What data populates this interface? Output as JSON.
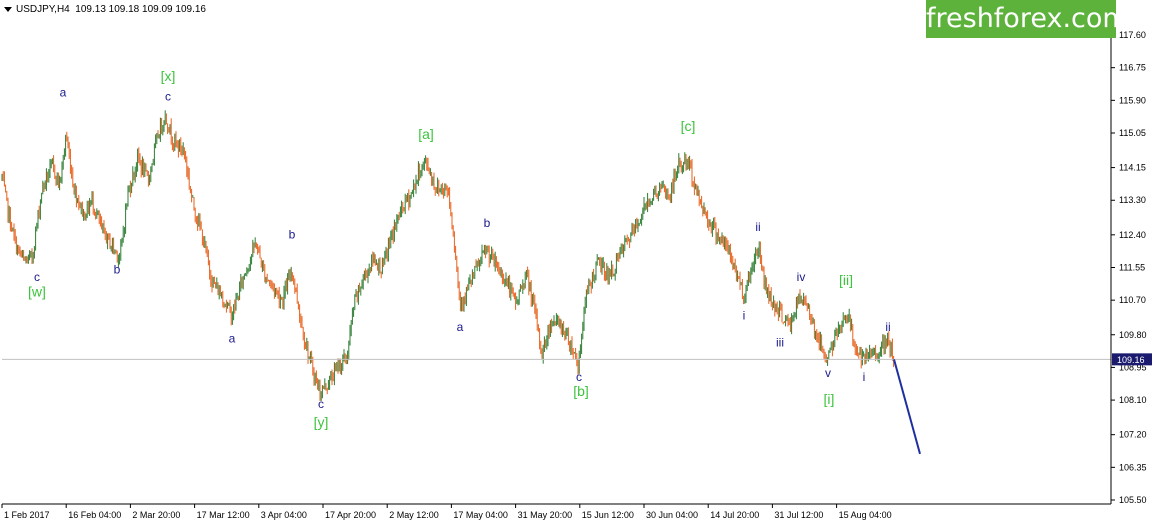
{
  "header": {
    "symbol": "USDJPY,H4",
    "ohlc": "109.13 109.18 109.09 109.16"
  },
  "logo": {
    "text": "freshforex.com"
  },
  "colors": {
    "up_candle": "#2e7d32",
    "down_candle": "#e8601c",
    "wave_green": "#3cc43c",
    "wave_blue": "#1a1a8c",
    "projection": "#1f2fa0",
    "price_line": "#c0c0c0",
    "price_badge": "#1a1a6e"
  },
  "chart_data": {
    "type": "candlestick",
    "y_ticks": [
      "117.60",
      "116.75",
      "115.90",
      "115.05",
      "114.15",
      "113.30",
      "112.40",
      "111.55",
      "110.70",
      "109.80",
      "108.95",
      "108.10",
      "107.20",
      "106.35",
      "105.50"
    ],
    "y_tick_values": [
      117.6,
      116.75,
      115.9,
      115.05,
      114.15,
      113.3,
      112.4,
      111.55,
      110.7,
      109.8,
      108.95,
      108.1,
      107.2,
      106.35,
      105.5
    ],
    "ylim": [
      105.5,
      117.6
    ],
    "x_ticks": [
      "1 Feb 2017",
      "16 Feb 04:00",
      "2 Mar 20:00",
      "17 Mar 12:00",
      "3 Apr 04:00",
      "17 Apr 20:00",
      "2 May 12:00",
      "17 May 04:00",
      "31 May 20:00",
      "15 Jun 12:00",
      "30 Jun 04:00",
      "14 Jul 20:00",
      "31 Jul 12:00",
      "15 Aug 04:00"
    ],
    "current_price": "109.16",
    "current_price_value": 109.16,
    "price_path": [
      {
        "t": 0,
        "p": 113.9
      },
      {
        "t": 6,
        "p": 113.0
      },
      {
        "t": 14,
        "p": 112.1
      },
      {
        "t": 22,
        "p": 111.7
      },
      {
        "t": 30,
        "p": 111.8
      },
      {
        "t": 40,
        "p": 113.6
      },
      {
        "t": 50,
        "p": 114.2
      },
      {
        "t": 58,
        "p": 113.7
      },
      {
        "t": 64,
        "p": 115.0
      },
      {
        "t": 72,
        "p": 113.6
      },
      {
        "t": 82,
        "p": 112.9
      },
      {
        "t": 90,
        "p": 113.3
      },
      {
        "t": 100,
        "p": 112.5
      },
      {
        "t": 110,
        "p": 112.1
      },
      {
        "t": 118,
        "p": 111.8
      },
      {
        "t": 126,
        "p": 113.5
      },
      {
        "t": 136,
        "p": 114.4
      },
      {
        "t": 146,
        "p": 113.8
      },
      {
        "t": 156,
        "p": 115.0
      },
      {
        "t": 163,
        "p": 115.5
      },
      {
        "t": 172,
        "p": 114.8
      },
      {
        "t": 182,
        "p": 114.6
      },
      {
        "t": 190,
        "p": 113.3
      },
      {
        "t": 200,
        "p": 112.4
      },
      {
        "t": 210,
        "p": 111.2
      },
      {
        "t": 220,
        "p": 110.8
      },
      {
        "t": 230,
        "p": 110.3
      },
      {
        "t": 240,
        "p": 111.2
      },
      {
        "t": 254,
        "p": 112.2
      },
      {
        "t": 262,
        "p": 111.4
      },
      {
        "t": 272,
        "p": 111.0
      },
      {
        "t": 280,
        "p": 110.7
      },
      {
        "t": 290,
        "p": 111.5
      },
      {
        "t": 300,
        "p": 110.0
      },
      {
        "t": 308,
        "p": 109.1
      },
      {
        "t": 318,
        "p": 108.3
      },
      {
        "t": 328,
        "p": 108.6
      },
      {
        "t": 336,
        "p": 109.0
      },
      {
        "t": 345,
        "p": 109.2
      },
      {
        "t": 352,
        "p": 110.6
      },
      {
        "t": 362,
        "p": 111.3
      },
      {
        "t": 372,
        "p": 111.8
      },
      {
        "t": 380,
        "p": 111.5
      },
      {
        "t": 390,
        "p": 112.4
      },
      {
        "t": 400,
        "p": 113.1
      },
      {
        "t": 410,
        "p": 113.5
      },
      {
        "t": 418,
        "p": 114.1
      },
      {
        "t": 424,
        "p": 114.3
      },
      {
        "t": 434,
        "p": 113.6
      },
      {
        "t": 446,
        "p": 113.6
      },
      {
        "t": 452,
        "p": 112.3
      },
      {
        "t": 458,
        "p": 110.6
      },
      {
        "t": 466,
        "p": 111.0
      },
      {
        "t": 474,
        "p": 111.5
      },
      {
        "t": 484,
        "p": 112.0
      },
      {
        "t": 494,
        "p": 111.6
      },
      {
        "t": 504,
        "p": 111.2
      },
      {
        "t": 514,
        "p": 110.6
      },
      {
        "t": 524,
        "p": 111.4
      },
      {
        "t": 532,
        "p": 110.5
      },
      {
        "t": 540,
        "p": 109.3
      },
      {
        "t": 550,
        "p": 110.2
      },
      {
        "t": 560,
        "p": 110.0
      },
      {
        "t": 570,
        "p": 109.5
      },
      {
        "t": 576,
        "p": 109.0
      },
      {
        "t": 584,
        "p": 110.8
      },
      {
        "t": 596,
        "p": 111.7
      },
      {
        "t": 608,
        "p": 111.3
      },
      {
        "t": 620,
        "p": 112.0
      },
      {
        "t": 634,
        "p": 112.6
      },
      {
        "t": 646,
        "p": 113.3
      },
      {
        "t": 658,
        "p": 113.6
      },
      {
        "t": 668,
        "p": 113.4
      },
      {
        "t": 676,
        "p": 114.2
      },
      {
        "t": 686,
        "p": 114.3
      },
      {
        "t": 696,
        "p": 113.4
      },
      {
        "t": 706,
        "p": 112.8
      },
      {
        "t": 716,
        "p": 112.4
      },
      {
        "t": 726,
        "p": 112.0
      },
      {
        "t": 736,
        "p": 111.3
      },
      {
        "t": 742,
        "p": 110.8
      },
      {
        "t": 750,
        "p": 111.6
      },
      {
        "t": 756,
        "p": 112.1
      },
      {
        "t": 764,
        "p": 111.0
      },
      {
        "t": 772,
        "p": 110.6
      },
      {
        "t": 780,
        "p": 110.3
      },
      {
        "t": 788,
        "p": 110.0
      },
      {
        "t": 796,
        "p": 110.7
      },
      {
        "t": 806,
        "p": 110.6
      },
      {
        "t": 814,
        "p": 109.8
      },
      {
        "t": 824,
        "p": 109.2
      },
      {
        "t": 832,
        "p": 109.6
      },
      {
        "t": 840,
        "p": 110.2
      },
      {
        "t": 846,
        "p": 110.3
      },
      {
        "t": 852,
        "p": 109.6
      },
      {
        "t": 860,
        "p": 109.1
      },
      {
        "t": 870,
        "p": 109.3
      },
      {
        "t": 878,
        "p": 109.4
      },
      {
        "t": 886,
        "p": 109.6
      },
      {
        "t": 892,
        "p": 109.16
      }
    ],
    "projection": [
      {
        "t": 892,
        "p": 109.16
      },
      {
        "t": 918,
        "p": 106.7
      }
    ],
    "wave_labels": [
      {
        "text": "a",
        "t": 61,
        "p": 116.0,
        "color": "blue"
      },
      {
        "text": "c",
        "t": 35,
        "p": 111.2,
        "color": "blue"
      },
      {
        "text": "[w]",
        "t": 35,
        "p": 110.8,
        "color": "green"
      },
      {
        "text": "b",
        "t": 115,
        "p": 111.4,
        "color": "blue"
      },
      {
        "text": "[x]",
        "t": 166,
        "p": 116.4,
        "color": "green"
      },
      {
        "text": "c",
        "t": 166,
        "p": 115.9,
        "color": "blue"
      },
      {
        "text": "a",
        "t": 230,
        "p": 109.6,
        "color": "blue"
      },
      {
        "text": "b",
        "t": 290,
        "p": 112.3,
        "color": "blue"
      },
      {
        "text": "c",
        "t": 319,
        "p": 107.9,
        "color": "blue"
      },
      {
        "text": "[y]",
        "t": 319,
        "p": 107.4,
        "color": "green"
      },
      {
        "text": "[a]",
        "t": 424,
        "p": 114.9,
        "color": "green"
      },
      {
        "text": "a",
        "t": 458,
        "p": 109.9,
        "color": "blue"
      },
      {
        "text": "b",
        "t": 485,
        "p": 112.6,
        "color": "blue"
      },
      {
        "text": "c",
        "t": 577,
        "p": 108.6,
        "color": "blue"
      },
      {
        "text": "[b]",
        "t": 579,
        "p": 108.2,
        "color": "green"
      },
      {
        "text": "[c]",
        "t": 686,
        "p": 115.1,
        "color": "green"
      },
      {
        "text": "ii",
        "t": 756,
        "p": 112.5,
        "color": "blue"
      },
      {
        "text": "i",
        "t": 742,
        "p": 110.2,
        "color": "blue"
      },
      {
        "text": "iv",
        "t": 799,
        "p": 111.2,
        "color": "blue"
      },
      {
        "text": "iii",
        "t": 778,
        "p": 109.5,
        "color": "blue"
      },
      {
        "text": "v",
        "t": 826,
        "p": 108.7,
        "color": "blue"
      },
      {
        "text": "[i]",
        "t": 827,
        "p": 108.0,
        "color": "green"
      },
      {
        "text": "[ii]",
        "t": 844,
        "p": 111.1,
        "color": "green"
      },
      {
        "text": "i",
        "t": 862,
        "p": 108.6,
        "color": "blue"
      },
      {
        "text": "ii",
        "t": 886,
        "p": 109.9,
        "color": "blue"
      }
    ]
  }
}
